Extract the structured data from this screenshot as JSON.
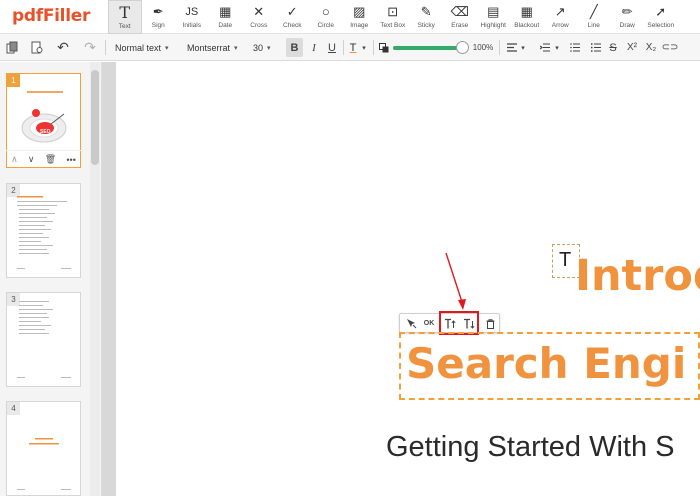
{
  "app": {
    "logo": "pdfFiller"
  },
  "tools": [
    {
      "label": "Text",
      "icon": "T",
      "name": "text"
    },
    {
      "label": "Sign",
      "icon": "✒",
      "name": "sign"
    },
    {
      "label": "Initials",
      "icon": "JS",
      "name": "initials"
    },
    {
      "label": "Date",
      "icon": "▦",
      "name": "date"
    },
    {
      "label": "Cross",
      "icon": "✕",
      "name": "cross"
    },
    {
      "label": "Check",
      "icon": "✓",
      "name": "check"
    },
    {
      "label": "Circle",
      "icon": "○",
      "name": "circle"
    },
    {
      "label": "Image",
      "icon": "▨",
      "name": "image"
    },
    {
      "label": "Text Box",
      "icon": "⊡",
      "name": "text-box"
    },
    {
      "label": "Sticky",
      "icon": "✎",
      "name": "sticky"
    },
    {
      "label": "Erase",
      "icon": "⌫",
      "name": "erase"
    },
    {
      "label": "Highlight",
      "icon": "▤",
      "name": "highlight"
    },
    {
      "label": "Blackout",
      "icon": "▦",
      "name": "blackout"
    },
    {
      "label": "Arrow",
      "icon": "↗",
      "name": "arrow"
    },
    {
      "label": "Line",
      "icon": "╱",
      "name": "line"
    },
    {
      "label": "Draw",
      "icon": "✏",
      "name": "draw"
    },
    {
      "label": "Selection",
      "icon": "➚",
      "name": "selection"
    }
  ],
  "format": {
    "style": "Normal text",
    "font": "Montserrat",
    "size": "30",
    "bold": "B",
    "italic": "I",
    "underline": "U",
    "color": "T",
    "zoom": "100%",
    "strike": "S",
    "superscript": "X²",
    "subscript": "X₂"
  },
  "thumbnails": [
    {
      "num": "1",
      "selected": true
    },
    {
      "num": "2",
      "selected": false
    },
    {
      "num": "3",
      "selected": false
    },
    {
      "num": "4",
      "selected": false
    }
  ],
  "thumb_seo": "SEO",
  "floating_toolbar": {
    "ok": "OK"
  },
  "canvas": {
    "cursor": "T",
    "heading1": "Introd",
    "heading2": "Search Engi",
    "heading3": "Getting Started With S"
  },
  "colors": {
    "accent": "#f0923e",
    "brand": "#e8522a",
    "highlight": "#e0191f",
    "slider": "#35a86b"
  }
}
